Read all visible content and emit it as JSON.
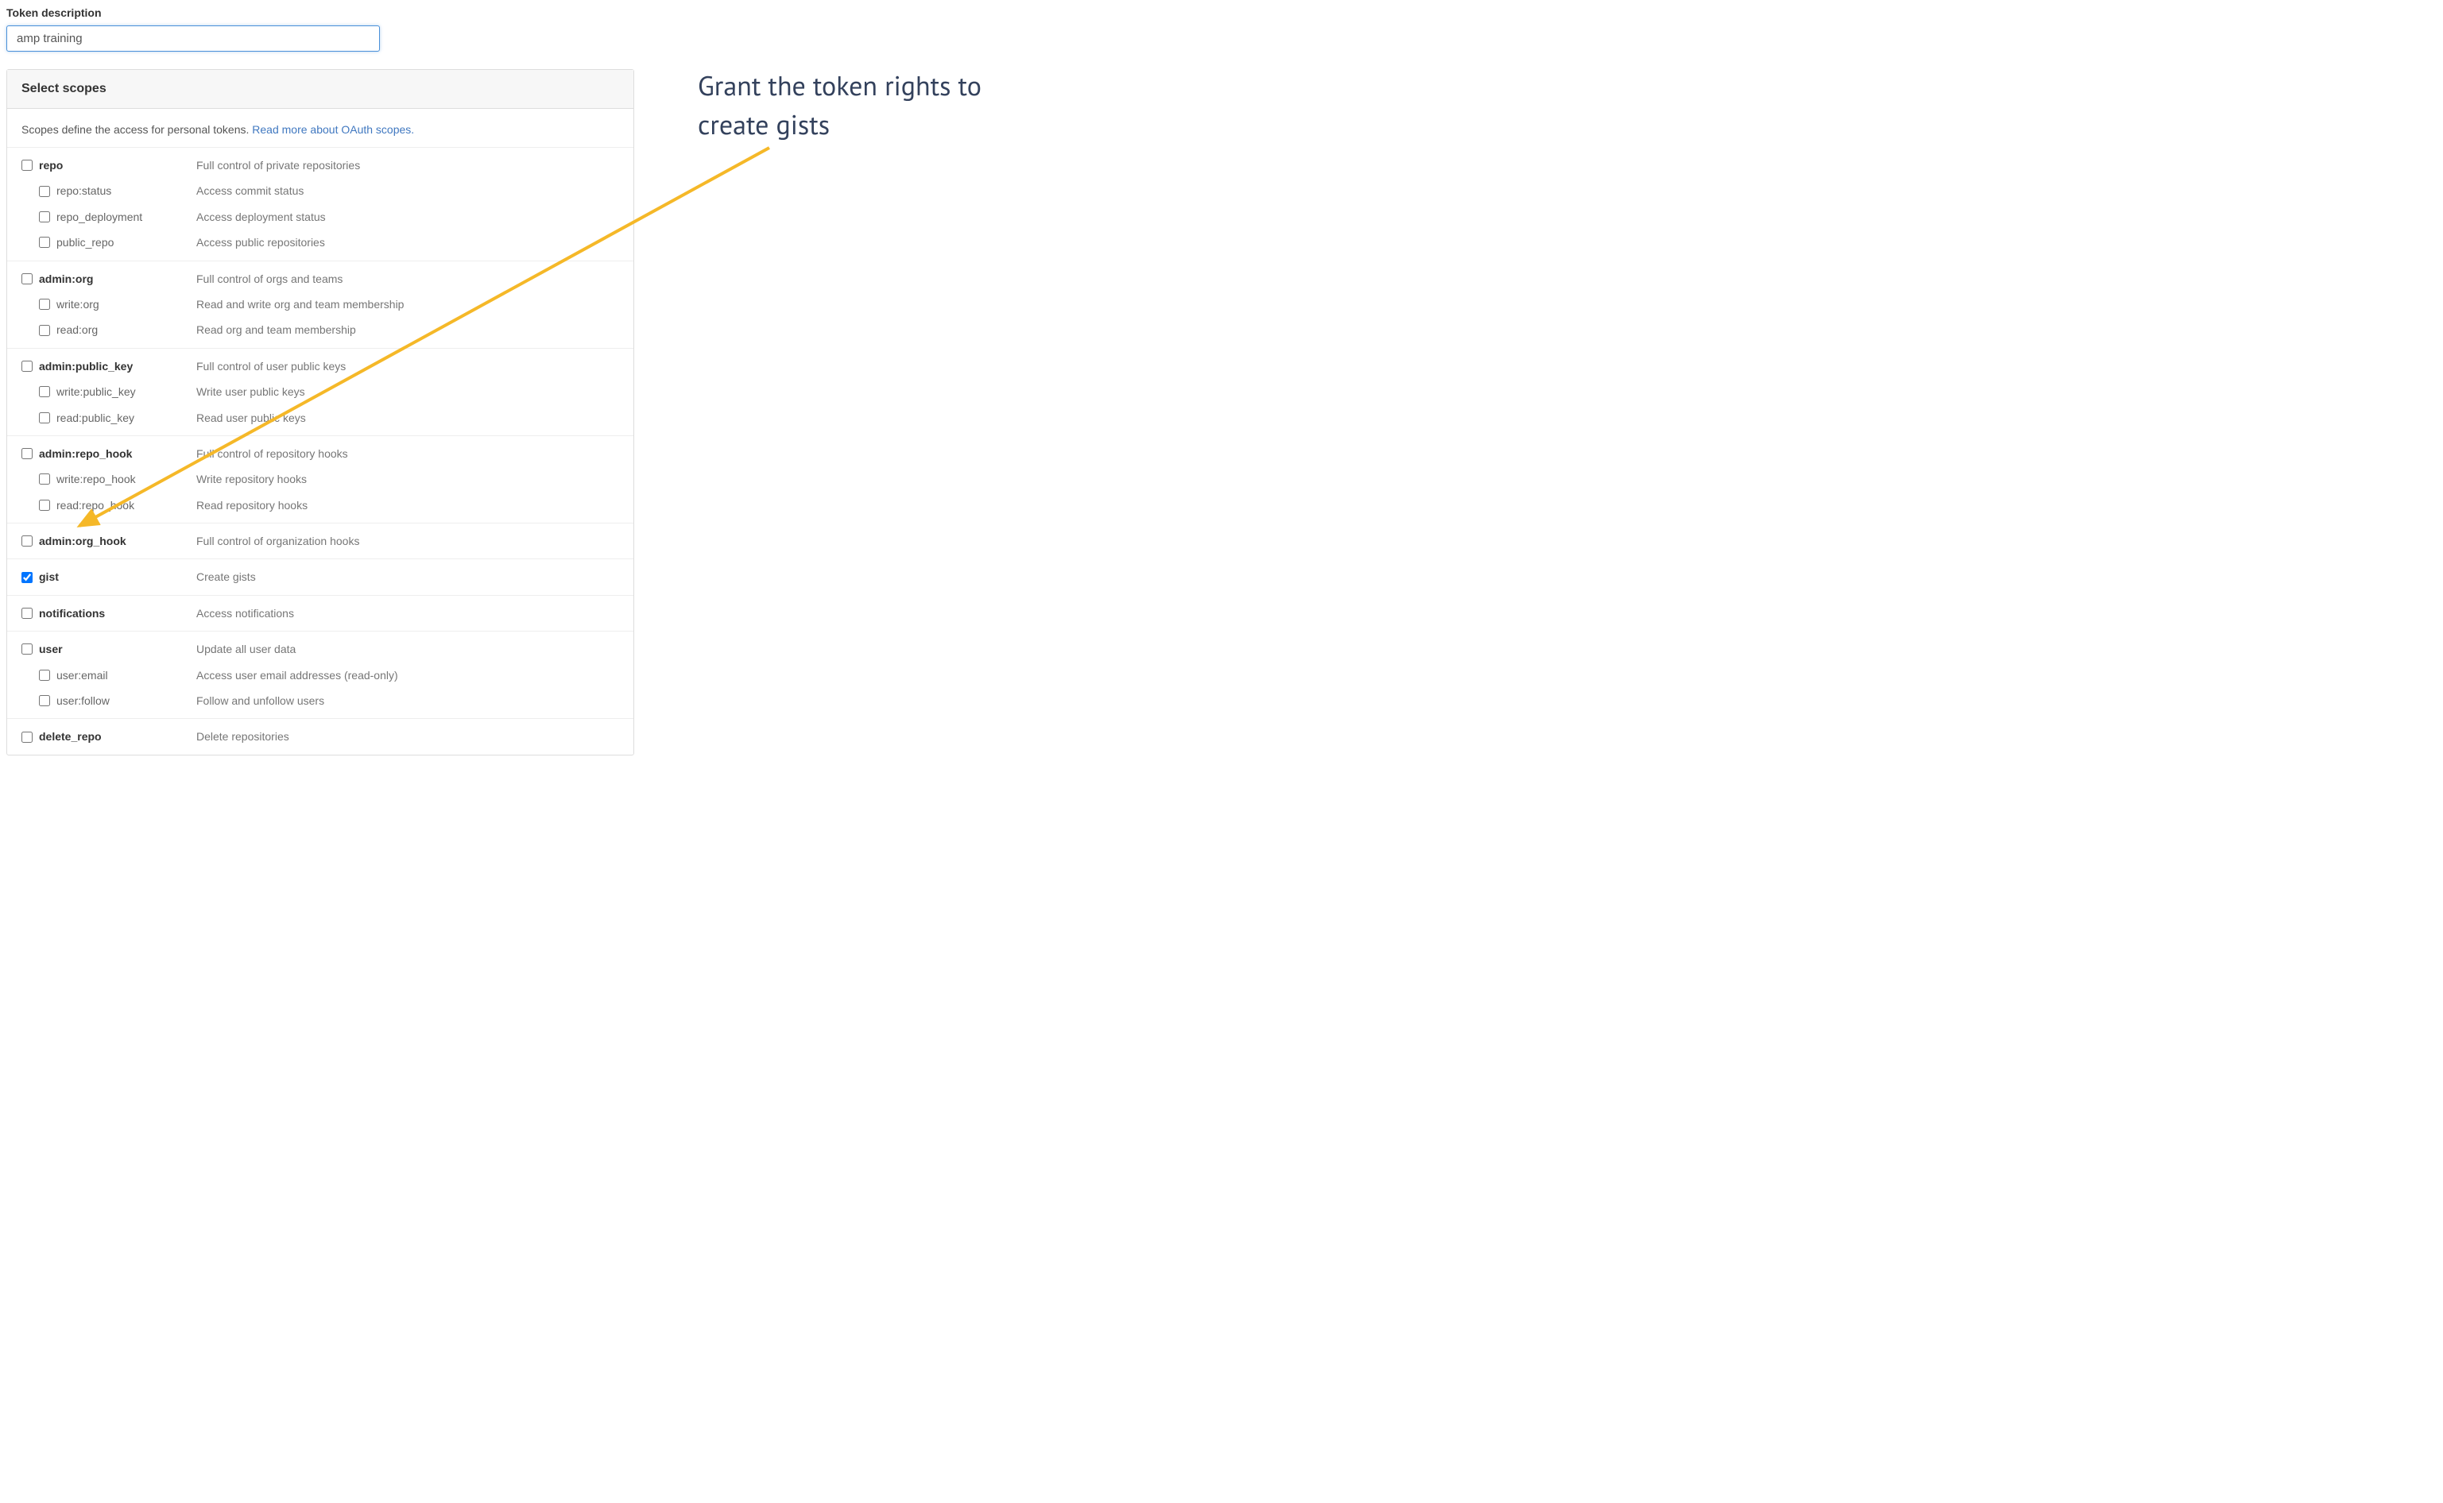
{
  "form": {
    "label": "Token description",
    "value": "amp training"
  },
  "panel": {
    "title": "Select scopes",
    "intro_text": "Scopes define the access for personal tokens. ",
    "intro_link": "Read more about OAuth scopes."
  },
  "scopes": [
    {
      "name": "repo",
      "desc": "Full control of private repositories",
      "checked": false,
      "children": [
        {
          "name": "repo:status",
          "desc": "Access commit status",
          "checked": false
        },
        {
          "name": "repo_deployment",
          "desc": "Access deployment status",
          "checked": false
        },
        {
          "name": "public_repo",
          "desc": "Access public repositories",
          "checked": false
        }
      ]
    },
    {
      "name": "admin:org",
      "desc": "Full control of orgs and teams",
      "checked": false,
      "children": [
        {
          "name": "write:org",
          "desc": "Read and write org and team membership",
          "checked": false
        },
        {
          "name": "read:org",
          "desc": "Read org and team membership",
          "checked": false
        }
      ]
    },
    {
      "name": "admin:public_key",
      "desc": "Full control of user public keys",
      "checked": false,
      "children": [
        {
          "name": "write:public_key",
          "desc": "Write user public keys",
          "checked": false
        },
        {
          "name": "read:public_key",
          "desc": "Read user public keys",
          "checked": false
        }
      ]
    },
    {
      "name": "admin:repo_hook",
      "desc": "Full control of repository hooks",
      "checked": false,
      "children": [
        {
          "name": "write:repo_hook",
          "desc": "Write repository hooks",
          "checked": false
        },
        {
          "name": "read:repo_hook",
          "desc": "Read repository hooks",
          "checked": false
        }
      ]
    },
    {
      "name": "admin:org_hook",
      "desc": "Full control of organization hooks",
      "checked": false,
      "children": []
    },
    {
      "name": "gist",
      "desc": "Create gists",
      "checked": true,
      "children": []
    },
    {
      "name": "notifications",
      "desc": "Access notifications",
      "checked": false,
      "children": []
    },
    {
      "name": "user",
      "desc": "Update all user data",
      "checked": false,
      "children": [
        {
          "name": "user:email",
          "desc": "Access user email addresses (read-only)",
          "checked": false
        },
        {
          "name": "user:follow",
          "desc": "Follow and unfollow users",
          "checked": false
        }
      ]
    },
    {
      "name": "delete_repo",
      "desc": "Delete repositories",
      "checked": false,
      "children": []
    }
  ],
  "annotation": {
    "line1": "Grant the token rights to",
    "line2": "create gists"
  },
  "arrow": {
    "color": "#f5b828"
  }
}
